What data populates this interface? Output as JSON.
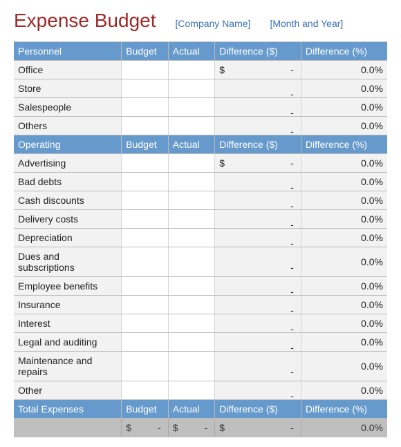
{
  "header": {
    "title": "Expense Budget",
    "company_placeholder": "[Company Name]",
    "date_placeholder": "[Month and Year]"
  },
  "columns": {
    "budget": "Budget",
    "actual": "Actual",
    "diff_dollar": "Difference ($)",
    "diff_percent": "Difference (%)"
  },
  "sections": [
    {
      "name": "Personnel",
      "rows": [
        {
          "label": "Office",
          "budget": "",
          "actual": "",
          "diff_prefix": "$",
          "diff_value": "-",
          "pct": "0.0%"
        },
        {
          "label": "Store",
          "budget": "",
          "actual": "",
          "diff_prefix": "",
          "diff_value": "-",
          "pct": "0.0%"
        },
        {
          "label": "Salespeople",
          "budget": "",
          "actual": "",
          "diff_prefix": "",
          "diff_value": "-",
          "pct": "0.0%"
        },
        {
          "label": "Others",
          "budget": "",
          "actual": "",
          "diff_prefix": "",
          "diff_value": "-",
          "pct": "0.0%"
        }
      ]
    },
    {
      "name": "Operating",
      "rows": [
        {
          "label": "Advertising",
          "budget": "",
          "actual": "",
          "diff_prefix": "$",
          "diff_value": "-",
          "pct": "0.0%"
        },
        {
          "label": "Bad debts",
          "budget": "",
          "actual": "",
          "diff_prefix": "",
          "diff_value": "-",
          "pct": "0.0%"
        },
        {
          "label": "Cash discounts",
          "budget": "",
          "actual": "",
          "diff_prefix": "",
          "diff_value": "-",
          "pct": "0.0%"
        },
        {
          "label": "Delivery costs",
          "budget": "",
          "actual": "",
          "diff_prefix": "",
          "diff_value": "-",
          "pct": "0.0%"
        },
        {
          "label": "Depreciation",
          "budget": "",
          "actual": "",
          "diff_prefix": "",
          "diff_value": "-",
          "pct": "0.0%"
        },
        {
          "label": "Dues and subscriptions",
          "budget": "",
          "actual": "",
          "diff_prefix": "",
          "diff_value": "-",
          "pct": "0.0%"
        },
        {
          "label": "Employee benefits",
          "budget": "",
          "actual": "",
          "diff_prefix": "",
          "diff_value": "-",
          "pct": "0.0%"
        },
        {
          "label": "Insurance",
          "budget": "",
          "actual": "",
          "diff_prefix": "",
          "diff_value": "-",
          "pct": "0.0%"
        },
        {
          "label": "Interest",
          "budget": "",
          "actual": "",
          "diff_prefix": "",
          "diff_value": "-",
          "pct": "0.0%"
        },
        {
          "label": "Legal and auditing",
          "budget": "",
          "actual": "",
          "diff_prefix": "",
          "diff_value": "-",
          "pct": "0.0%"
        },
        {
          "label": "Maintenance and repairs",
          "budget": "",
          "actual": "",
          "diff_prefix": "",
          "diff_value": "-",
          "pct": "0.0%"
        },
        {
          "label": "Other",
          "budget": "",
          "actual": "",
          "diff_prefix": "",
          "diff_value": "-",
          "pct": "0.0%"
        }
      ]
    }
  ],
  "total": {
    "label": "Total  Expenses",
    "budget": "$",
    "actual": "$",
    "diff_prefix": "$",
    "diff_value": "-",
    "pct": "0.0%"
  }
}
